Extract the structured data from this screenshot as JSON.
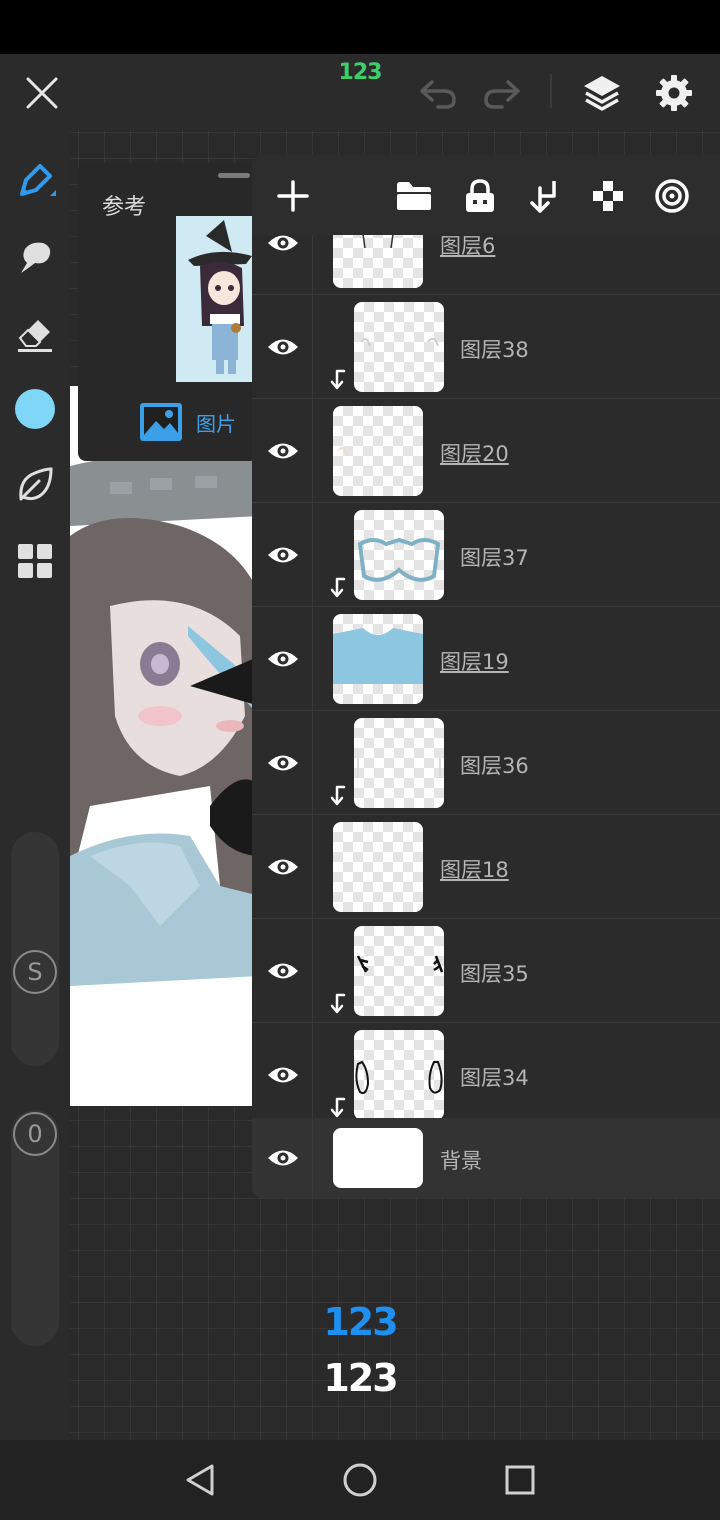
{
  "app": {
    "project_title": "123"
  },
  "topbar": {
    "icons": [
      "close-icon",
      "undo-icon",
      "redo-icon",
      "layers-icon",
      "settings-icon"
    ]
  },
  "tools": {
    "items": [
      "pen-icon",
      "smudge-icon",
      "eraser-icon",
      "color-swatch",
      "leaf-icon",
      "grid-icon"
    ],
    "current_color": "#7fd6f7",
    "size_slider_label": "S",
    "opacity_slider_label": "0"
  },
  "reference": {
    "label": "参考",
    "picture_label": "图片"
  },
  "layers_toolbar": {
    "icons": [
      "add-icon",
      "folder-icon",
      "lock-icon",
      "clip-down-icon",
      "transparency-icon",
      "target-icon"
    ]
  },
  "layers": [
    {
      "name": "图层6",
      "clipped": false,
      "underline": true
    },
    {
      "name": "图层38",
      "clipped": true,
      "underline": false
    },
    {
      "name": "图层20",
      "clipped": false,
      "underline": true
    },
    {
      "name": "图层37",
      "clipped": true,
      "underline": false
    },
    {
      "name": "图层19",
      "clipped": false,
      "underline": true
    },
    {
      "name": "图层36",
      "clipped": true,
      "underline": false
    },
    {
      "name": "图层18",
      "clipped": false,
      "underline": true
    },
    {
      "name": "图层35",
      "clipped": true,
      "underline": false
    },
    {
      "name": "图层34",
      "clipped": true,
      "underline": false
    }
  ],
  "background_layer": {
    "name": "背景"
  },
  "canvas_text": {
    "blue": "123",
    "white": "123"
  },
  "colors": {
    "accent_blue": "#3ca0e8",
    "title_green": "#3ccf6a"
  }
}
